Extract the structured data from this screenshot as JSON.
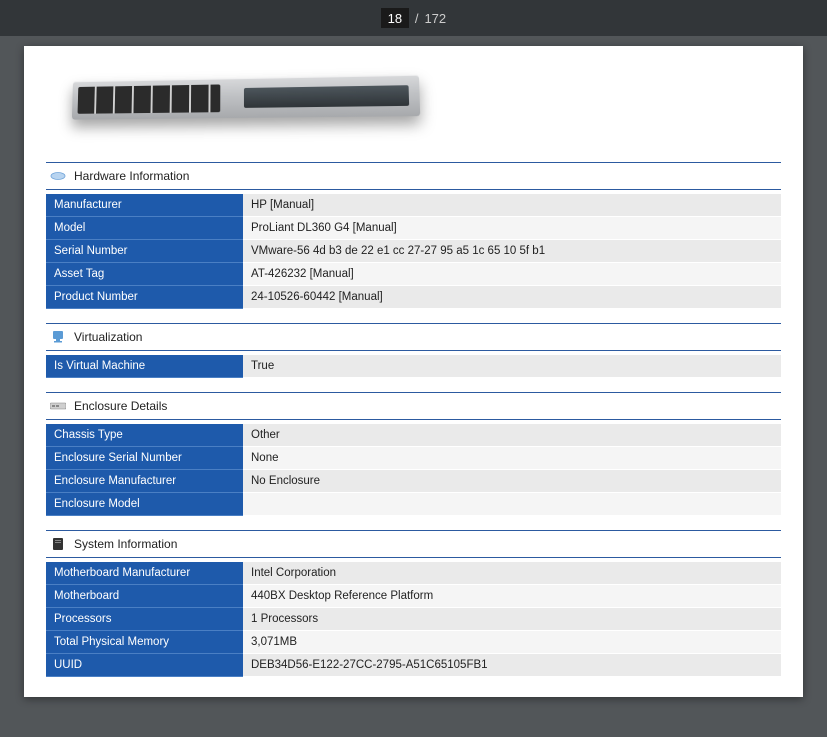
{
  "pager": {
    "current": "18",
    "total": "172"
  },
  "sections": [
    {
      "title": "Hardware Information",
      "icon": "chip-icon",
      "rows": [
        {
          "label": "Manufacturer",
          "value": "HP [Manual]"
        },
        {
          "label": "Model",
          "value": "ProLiant DL360 G4 [Manual]"
        },
        {
          "label": "Serial Number",
          "value": "VMware-56 4d b3 de 22 e1 cc 27-27 95 a5 1c 65 10 5f b1"
        },
        {
          "label": "Asset Tag",
          "value": "AT-426232 [Manual]"
        },
        {
          "label": "Product Number",
          "value": "24-10526-60442 [Manual]"
        }
      ]
    },
    {
      "title": "Virtualization",
      "icon": "virtualization-icon",
      "rows": [
        {
          "label": "Is Virtual Machine",
          "value": "True"
        }
      ]
    },
    {
      "title": "Enclosure Details",
      "icon": "enclosure-icon",
      "rows": [
        {
          "label": "Chassis Type",
          "value": "Other"
        },
        {
          "label": "Enclosure Serial Number",
          "value": "None"
        },
        {
          "label": "Enclosure Manufacturer",
          "value": "No Enclosure"
        },
        {
          "label": "Enclosure Model",
          "value": ""
        }
      ]
    },
    {
      "title": "System Information",
      "icon": "system-icon",
      "rows": [
        {
          "label": "Motherboard Manufacturer",
          "value": "Intel Corporation"
        },
        {
          "label": "Motherboard",
          "value": "440BX Desktop Reference Platform"
        },
        {
          "label": "Processors",
          "value": "1 Processors"
        },
        {
          "label": "Total Physical Memory",
          "value": "3,071MB"
        },
        {
          "label": "UUID",
          "value": "DEB34D56-E122-27CC-2795-A51C65105FB1"
        }
      ]
    }
  ]
}
